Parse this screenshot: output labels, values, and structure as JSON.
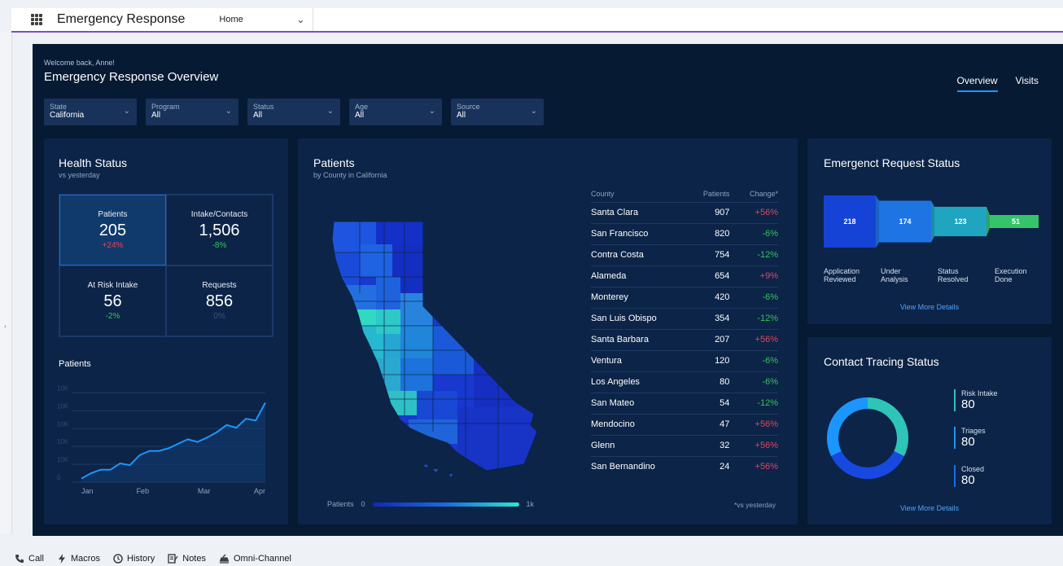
{
  "nav": {
    "app_name": "Emergency Response",
    "tab": "Home"
  },
  "dashboard": {
    "welcome": "Welcome back, Anne!",
    "title": "Emergency Response Overview",
    "tabs": [
      "Overview",
      "Visits"
    ],
    "filters": [
      {
        "label": "State",
        "value": "California"
      },
      {
        "label": "Program",
        "value": "All"
      },
      {
        "label": "Status",
        "value": "All"
      },
      {
        "label": "Age",
        "value": "All"
      },
      {
        "label": "Source",
        "value": "All"
      }
    ]
  },
  "health": {
    "title": "Health Status",
    "subtitle": "vs yesterday",
    "kpis": [
      {
        "label": "Patients",
        "value": "205",
        "change": "+24%"
      },
      {
        "label": "Intake/Contacts",
        "value": "1,506",
        "change": "-8%"
      },
      {
        "label": "At Risk Intake",
        "value": "56",
        "change": "-2%"
      },
      {
        "label": "Requests",
        "value": "856",
        "change": "0%"
      }
    ],
    "chart_title": "Patients"
  },
  "chart_data": {
    "type": "line",
    "title": "Patients",
    "x_ticks": [
      "Jan",
      "Feb",
      "Mar",
      "Apr"
    ],
    "y_ticks": [
      "0",
      "10K",
      "10K",
      "10K",
      "10K",
      "10K"
    ],
    "y": [
      0.4,
      1.0,
      1.4,
      1.4,
      2.1,
      1.9,
      3.0,
      3.5,
      3.5,
      3.8,
      4.3,
      4.8,
      4.5,
      5.0,
      5.6,
      6.4,
      6.1,
      7.1,
      6.9,
      8.9
    ],
    "ylim": [
      0,
      11.5
    ]
  },
  "patients": {
    "title": "Patients",
    "subtitle": "by County in California",
    "columns": [
      "County",
      "Patients",
      "Change*"
    ],
    "rows": [
      [
        "Santa Clara",
        "907",
        "+56%"
      ],
      [
        "San Francisco",
        "820",
        "-6%"
      ],
      [
        "Contra Costa",
        "754",
        "-12%"
      ],
      [
        "Alameda",
        "654",
        "+9%"
      ],
      [
        "Monterey",
        "420",
        "-6%"
      ],
      [
        "San Luis Obispo",
        "354",
        "-12%"
      ],
      [
        "Santa Barbara",
        "207",
        "+56%"
      ],
      [
        "Ventura",
        "120",
        "-6%"
      ],
      [
        "Los Angeles",
        "80",
        "-6%"
      ],
      [
        "San Mateo",
        "54",
        "-12%"
      ],
      [
        "Mendocino",
        "47",
        "+56%"
      ],
      [
        "Glenn",
        "32",
        "+56%"
      ],
      [
        "San Bernandino",
        "24",
        "+56%"
      ]
    ],
    "legend_label": "Patients",
    "legend_min": "0",
    "legend_max": "1k",
    "footnote": "*vs yesterday"
  },
  "request": {
    "title": "Emergenct Request Status",
    "stages": [
      {
        "value": "218",
        "label": "Application Reviewed",
        "color": "#1543d6"
      },
      {
        "value": "174",
        "label": "Under Analysis",
        "color": "#1f74e3"
      },
      {
        "value": "123",
        "label": "Status Resolved",
        "color": "#20a5c0"
      },
      {
        "value": "51",
        "label": "Execution Done",
        "color": "#36c46a"
      }
    ],
    "link": "View More Details"
  },
  "contact": {
    "title": "Contact Tracing Status",
    "stats": [
      {
        "label": "Risk Intake",
        "value": "80",
        "color": "#2ec4b6"
      },
      {
        "label": "Triages",
        "value": "80",
        "color": "#1b96ff"
      },
      {
        "label": "Closed",
        "value": "80",
        "color": "#1a6fe8"
      }
    ],
    "link": "View More Details"
  },
  "utility": [
    "Call",
    "Macros",
    "History",
    "Notes",
    "Omni-Channel"
  ],
  "colors": {
    "dashboard_bg": "#061a33",
    "panel_bg": "#0c2447",
    "accent": "#1b96ff",
    "positive": "#e0465e",
    "negative": "#37c35f"
  }
}
